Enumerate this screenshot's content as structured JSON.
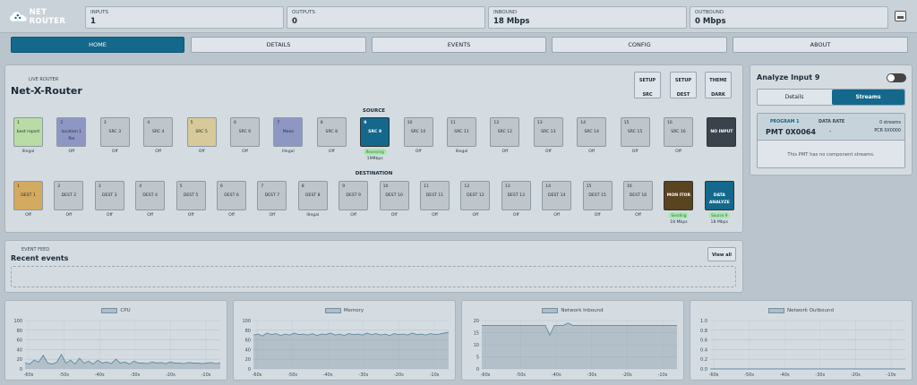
{
  "header": {
    "logo_text": "NET ROUTER",
    "stats": [
      {
        "label": "INPUTS",
        "value": "1"
      },
      {
        "label": "OUTPUTS",
        "value": "0"
      },
      {
        "label": "INBOUND",
        "value": "18 Mbps"
      },
      {
        "label": "OUTBOUND",
        "value": "0 Mbps"
      }
    ],
    "settings_icon": "monitor-settings-icon"
  },
  "nav": [
    "HOME",
    "DETAILS",
    "EVENTS",
    "CONFIG",
    "ABOUT"
  ],
  "router": {
    "kicker": "LIVE ROUTER",
    "title": "Net-X-Router",
    "buttons": [
      {
        "top": "SETUP",
        "bottom": "SRC"
      },
      {
        "top": "SETUP",
        "bottom": "DEST"
      },
      {
        "top": "THEME",
        "bottom": "DARK"
      }
    ],
    "source_label": "SOURCE",
    "dest_label": "DESTINATION",
    "sources": [
      {
        "n": "1",
        "label": "best report",
        "sub": "Illegal",
        "color": "#b9dba6"
      },
      {
        "n": "2",
        "label": "location 1 file",
        "sub": "Off",
        "color": "#8e97c4"
      },
      {
        "n": "3",
        "label": "SRC 3",
        "sub": "Off",
        "color": ""
      },
      {
        "n": "4",
        "label": "SRC 4",
        "sub": "Off",
        "color": ""
      },
      {
        "n": "5",
        "label": "SRC 5",
        "sub": "Off",
        "color": "#d7c99a"
      },
      {
        "n": "6",
        "label": "SRC 6",
        "sub": "Off",
        "color": ""
      },
      {
        "n": "7",
        "label": "Mooo",
        "sub": "Illegal",
        "color": "#8e97c4"
      },
      {
        "n": "8",
        "label": "SRC 8",
        "sub": "Off",
        "color": ""
      },
      {
        "n": "9",
        "label": "SRC 9",
        "sub": "19Mbps",
        "pill": "Receiving",
        "color": "#14688c",
        "light": true
      },
      {
        "n": "10",
        "label": "SRC 10",
        "sub": "Off",
        "color": ""
      },
      {
        "n": "11",
        "label": "SRC 11",
        "sub": "Illegal",
        "color": ""
      },
      {
        "n": "12",
        "label": "SRC 12",
        "sub": "Off",
        "color": ""
      },
      {
        "n": "13",
        "label": "SRC 13",
        "sub": "Off",
        "color": ""
      },
      {
        "n": "14",
        "label": "SRC 14",
        "sub": "Off",
        "color": ""
      },
      {
        "n": "15",
        "label": "SRC 15",
        "sub": "Off",
        "color": ""
      },
      {
        "n": "16",
        "label": "SRC 16",
        "sub": "Off",
        "color": ""
      },
      {
        "n": "",
        "label": "NO INPUT",
        "sub": "",
        "color": "#3a434b",
        "light": true
      }
    ],
    "dests": [
      {
        "n": "1",
        "label": "DEST 1",
        "sub": "Off",
        "color": "#d4aa60"
      },
      {
        "n": "2",
        "label": "DEST 2",
        "sub": "Off",
        "color": ""
      },
      {
        "n": "3",
        "label": "DEST 3",
        "sub": "Off",
        "color": ""
      },
      {
        "n": "4",
        "label": "DEST 4",
        "sub": "Off",
        "color": ""
      },
      {
        "n": "5",
        "label": "DEST 5",
        "sub": "Off",
        "color": ""
      },
      {
        "n": "6",
        "label": "DEST 6",
        "sub": "Off",
        "color": ""
      },
      {
        "n": "7",
        "label": "DEST 7",
        "sub": "Off",
        "color": ""
      },
      {
        "n": "8",
        "label": "DEST 8",
        "sub": "Illegal",
        "color": ""
      },
      {
        "n": "9",
        "label": "DEST 9",
        "sub": "Off",
        "color": ""
      },
      {
        "n": "10",
        "label": "DEST 10",
        "sub": "Off",
        "color": ""
      },
      {
        "n": "11",
        "label": "DEST 11",
        "sub": "Off",
        "color": ""
      },
      {
        "n": "12",
        "label": "DEST 12",
        "sub": "Off",
        "color": ""
      },
      {
        "n": "13",
        "label": "DEST 13",
        "sub": "Off",
        "color": ""
      },
      {
        "n": "14",
        "label": "DEST 14",
        "sub": "Off",
        "color": ""
      },
      {
        "n": "15",
        "label": "DEST 15",
        "sub": "Off",
        "color": ""
      },
      {
        "n": "16",
        "label": "DEST 16",
        "sub": "Off",
        "color": ""
      },
      {
        "n": "",
        "label": "MON ITOR",
        "sub": "18 Mbps",
        "pill": "Sending",
        "color": "#5a4420",
        "light": true
      },
      {
        "n": "",
        "label": "DATA ANALYZE",
        "sub": "18 Mbps",
        "pill": "Source 9",
        "color": "#14688c",
        "light": true
      }
    ]
  },
  "analyze": {
    "title": "Analyze Input 9",
    "tabs": [
      "Details",
      "Streams"
    ],
    "program_label": "PROGRAM 1",
    "program_value": "PMT 0X0064",
    "rate_label": "DATA RATE",
    "rate_value": "-",
    "streams_label": "0 streams",
    "pcr_label": "PCR 0X0000",
    "empty_msg": "This PMT has no component streams."
  },
  "events": {
    "kicker": "EVENT FEED",
    "title": "Recent events",
    "view_all": "View all"
  },
  "chart_data": [
    {
      "type": "line",
      "series": [
        {
          "name": "CPU",
          "values": [
            12,
            10,
            18,
            14,
            28,
            12,
            10,
            14,
            30,
            12,
            18,
            10,
            22,
            12,
            16,
            10,
            18,
            12,
            14,
            11,
            20,
            12,
            14,
            10,
            16,
            12,
            12,
            11,
            14,
            12,
            13,
            11,
            14,
            12,
            12,
            11,
            13,
            12,
            12,
            11,
            12,
            13,
            11,
            12
          ]
        }
      ],
      "ylim": [
        0,
        100
      ],
      "yticks": [
        0,
        20,
        40,
        60,
        80,
        100
      ],
      "xticks": [
        "-60s",
        "-50s",
        "-40s",
        "-30s",
        "-20s",
        "-10s"
      ]
    },
    {
      "type": "line",
      "series": [
        {
          "name": "Memory",
          "values": [
            70,
            72,
            68,
            74,
            71,
            73,
            69,
            72,
            70,
            74,
            71,
            72,
            70,
            73,
            69,
            72,
            71,
            74,
            70,
            72,
            69,
            73,
            71,
            72,
            70,
            74,
            71,
            73,
            70,
            72,
            69,
            73,
            71,
            72,
            70,
            74,
            71,
            72,
            70,
            73,
            71,
            72,
            74,
            76
          ]
        }
      ],
      "ylim": [
        0,
        100
      ],
      "yticks": [
        0,
        20,
        40,
        60,
        80,
        100
      ],
      "xticks": [
        "-60s",
        "-50s",
        "-40s",
        "-30s",
        "-20s",
        "-10s"
      ]
    },
    {
      "type": "line",
      "series": [
        {
          "name": "Network Inbound",
          "values": [
            18,
            18,
            18,
            18,
            18,
            18,
            18,
            18,
            18,
            18,
            18,
            18,
            18,
            18,
            18,
            14,
            18,
            18,
            18,
            19,
            18,
            18,
            18,
            18,
            18,
            18,
            18,
            18,
            18,
            18,
            18,
            18,
            18,
            18,
            18,
            18,
            18,
            18,
            18,
            18,
            18,
            18,
            18,
            18
          ]
        }
      ],
      "ylim": [
        0,
        20
      ],
      "yticks": [
        0,
        5,
        10,
        15,
        20
      ],
      "xticks": [
        "-60s",
        "-50s",
        "-40s",
        "-30s",
        "-20s",
        "-10s"
      ]
    },
    {
      "type": "line",
      "series": [
        {
          "name": "Network Outbound",
          "values": [
            0,
            0,
            0,
            0,
            0,
            0,
            0,
            0,
            0,
            0,
            0,
            0,
            0,
            0,
            0,
            0,
            0,
            0,
            0,
            0,
            0,
            0,
            0,
            0,
            0,
            0,
            0,
            0,
            0,
            0,
            0,
            0,
            0,
            0,
            0,
            0,
            0,
            0,
            0,
            0,
            0,
            0,
            0,
            0
          ]
        }
      ],
      "ylim": [
        0,
        1
      ],
      "yticks": [
        0,
        0.2,
        0.4,
        0.6,
        0.8,
        1.0
      ],
      "xticks": [
        "-60s",
        "-50s",
        "-40s",
        "-30s",
        "-20s",
        "-10s"
      ]
    }
  ]
}
